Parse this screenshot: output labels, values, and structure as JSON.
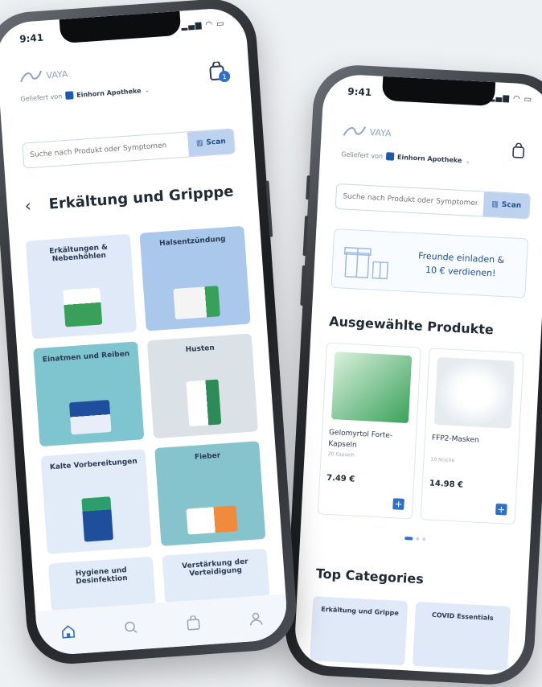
{
  "colors": {
    "brand": "#2f6fc4",
    "tile_blue": "#dfe9f7",
    "tile_teal": "#7fc5cf",
    "tile_gray": "#dbe2e7"
  },
  "phone_left": {
    "status_time": "9:41",
    "logo_text": "VAYA",
    "delivered_by_label": "Geliefert von",
    "pharmacy_name": "Einhorn Apotheke",
    "cart_badge": "1",
    "search_placeholder": "Suche nach Produkt oder Symptomen",
    "scan_label": "Scan",
    "category_title": "Erkältung und Gripppe",
    "tiles": [
      {
        "label": "Erkältungen & Nebenhöhlen"
      },
      {
        "label": "Halsentzündung"
      },
      {
        "label": "Einatmen und Reiben"
      },
      {
        "label": "Husten"
      },
      {
        "label": "Kalte Vorbereitungen"
      },
      {
        "label": "Fieber"
      },
      {
        "label": "Hygiene und Desinfektion"
      },
      {
        "label": "Verstärkung der Verteidigung"
      }
    ],
    "tab_icons": [
      "home-icon",
      "search-icon",
      "cart-icon",
      "profile-icon"
    ]
  },
  "phone_right": {
    "status_time": "9:41",
    "logo_text": "VAYA",
    "delivered_by_label": "Geliefert von",
    "pharmacy_name": "Einhorn Apotheke",
    "search_placeholder": "Suche nach Produkt oder Symptomen",
    "scan_label": "Scan",
    "promo_line1": "Freunde einladen &",
    "promo_line2": "10 € verdienen!",
    "featured_title": "Ausgewählte Produkte",
    "products": [
      {
        "name": "Gelomyrtol Forte-Kapseln",
        "sub": "20 Kapseln",
        "price": "7.49 €"
      },
      {
        "name": "FFP2-Masken",
        "sub": "10 Stücke",
        "price": "14.98 €"
      }
    ],
    "top_categories_title": "Top Categories",
    "top_categories": [
      {
        "label": "Erkältung und Grippe"
      },
      {
        "label": "COVID Essentials"
      }
    ]
  }
}
